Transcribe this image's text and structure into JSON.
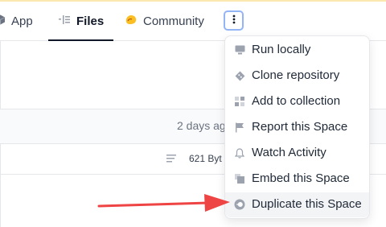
{
  "tabs": [
    {
      "label": "App",
      "icon": "cube-icon"
    },
    {
      "label": "Files",
      "icon": "files-icon"
    },
    {
      "label": "Community",
      "icon": "community-icon"
    }
  ],
  "background": {
    "last_modified": "2 days ag",
    "file_size": "621 Byt"
  },
  "menu": {
    "items": [
      {
        "label": "Run locally",
        "icon": "computer-icon"
      },
      {
        "label": "Clone repository",
        "icon": "git-icon"
      },
      {
        "label": "Add to collection",
        "icon": "collection-icon"
      },
      {
        "label": "Report this Space",
        "icon": "flag-icon"
      },
      {
        "label": "Watch Activity",
        "icon": "bell-icon"
      },
      {
        "label": "Embed this Space",
        "icon": "embed-icon"
      },
      {
        "label": "Duplicate this Space",
        "icon": "duplicate-icon"
      }
    ]
  },
  "colors": {
    "arrow": "#ef4444",
    "focus_ring": "#93b4f5",
    "community_icon": "#fbbf24"
  }
}
